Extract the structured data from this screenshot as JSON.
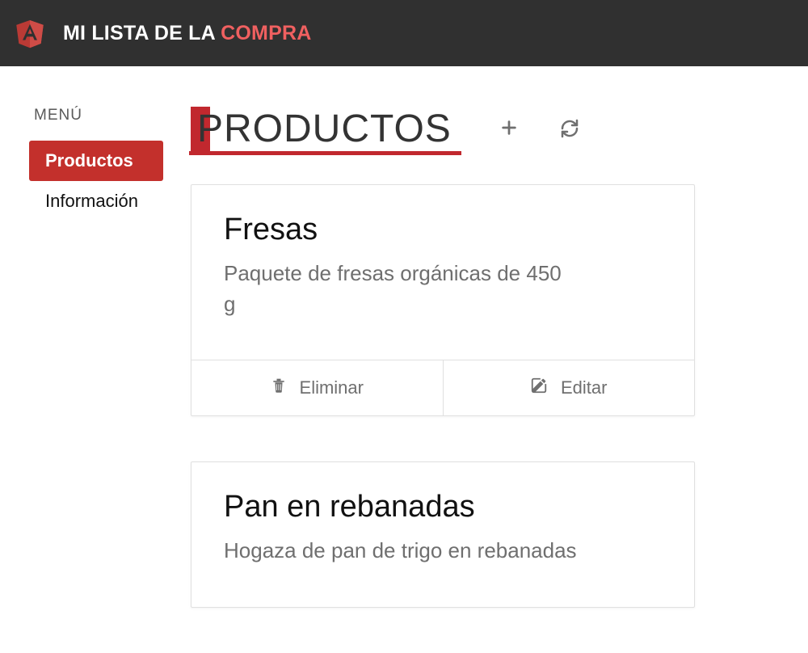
{
  "header": {
    "title_prefix": "MI ",
    "title_mid": "LISTA DE LA ",
    "title_accent": "COMPRA"
  },
  "sidebar": {
    "menu_label": "MENÚ",
    "items": [
      {
        "label": "Productos",
        "active": true
      },
      {
        "label": "Información",
        "active": false
      }
    ]
  },
  "main": {
    "page_title": "PRODUCTOS",
    "actions": {
      "delete_label": "Eliminar",
      "edit_label": "Editar"
    },
    "products": [
      {
        "name": "Fresas",
        "description": "Paquete de fresas orgánicas de 450 g"
      },
      {
        "name": "Pan en rebanadas",
        "description": "Hogaza de pan de trigo en rebanadas"
      }
    ]
  }
}
